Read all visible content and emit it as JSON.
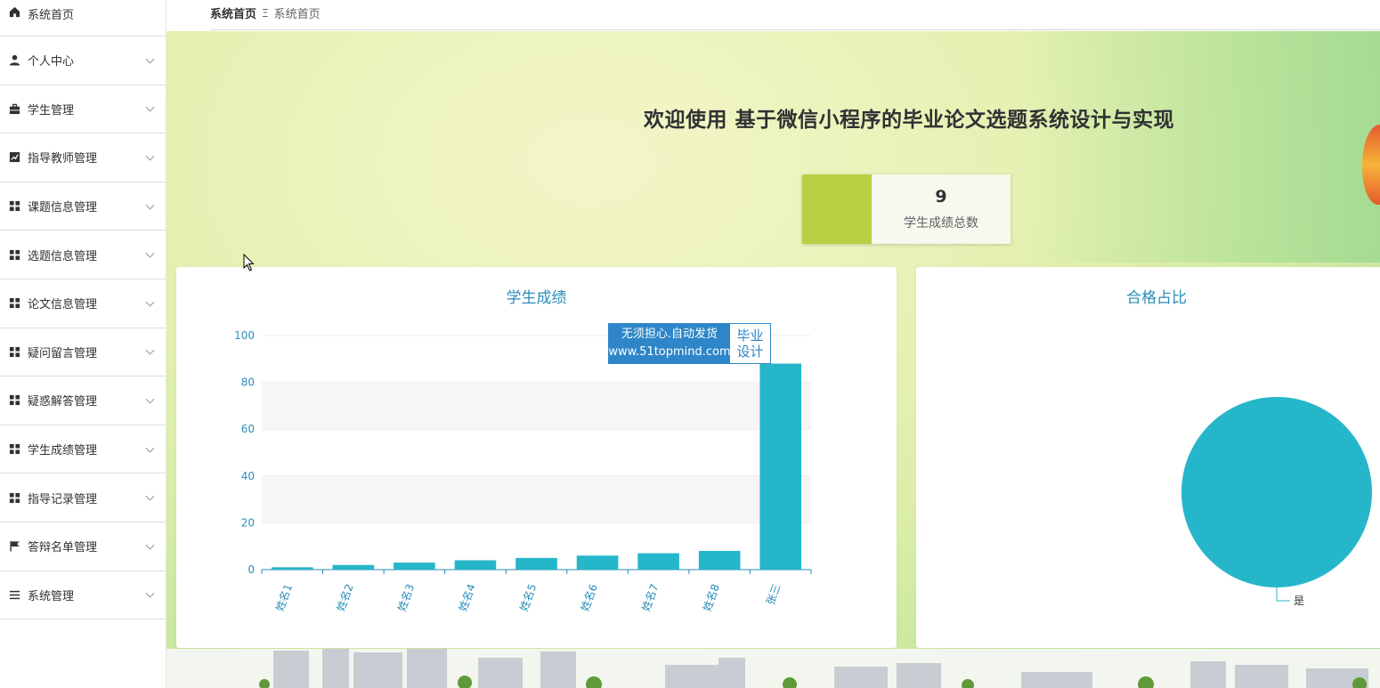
{
  "sidebar": {
    "items": [
      {
        "label": "系统首页",
        "icon": "home-icon"
      },
      {
        "label": "个人中心",
        "icon": "user-icon"
      },
      {
        "label": "学生管理",
        "icon": "briefcase-icon"
      },
      {
        "label": "指导教师管理",
        "icon": "chart-line-icon"
      },
      {
        "label": "课题信息管理",
        "icon": "grid-icon"
      },
      {
        "label": "选题信息管理",
        "icon": "grid-icon"
      },
      {
        "label": "论文信息管理",
        "icon": "grid-icon"
      },
      {
        "label": "疑问留言管理",
        "icon": "grid-icon"
      },
      {
        "label": "疑惑解答管理",
        "icon": "grid-icon"
      },
      {
        "label": "学生成绩管理",
        "icon": "grid-icon"
      },
      {
        "label": "指导记录管理",
        "icon": "grid-icon"
      },
      {
        "label": "答辩名单管理",
        "icon": "flag-icon"
      },
      {
        "label": "系统管理",
        "icon": "menu-icon"
      }
    ]
  },
  "breadcrumb": {
    "current": "系统首页",
    "separator": "Ξ",
    "item": "系统首页"
  },
  "welcome": {
    "title": "欢迎使用 基于微信小程序的毕业论文选题系统设计与实现"
  },
  "stat": {
    "value": "9",
    "label": "学生成绩总数",
    "color": "#b7d042"
  },
  "watermark": {
    "line1": "无须担心.自动发货",
    "line2": "www.51topmind.com",
    "right1": "毕业",
    "right2": "设计"
  },
  "chart_data": [
    {
      "type": "bar",
      "title": "学生成绩",
      "categories": [
        "姓名1",
        "姓名2",
        "姓名3",
        "姓名4",
        "姓名5",
        "姓名6",
        "姓名7",
        "姓名8",
        "张三"
      ],
      "values": [
        1,
        2,
        3,
        4,
        5,
        6,
        7,
        8,
        88
      ],
      "ylim": [
        0,
        100
      ],
      "yticks": [
        0,
        20,
        40,
        60,
        80,
        100
      ],
      "color": "#26b6c9",
      "grid": true
    },
    {
      "type": "pie",
      "title": "合格占比",
      "slices": [
        {
          "label": "是",
          "value": 100
        }
      ],
      "color": "#26b6c9"
    }
  ]
}
